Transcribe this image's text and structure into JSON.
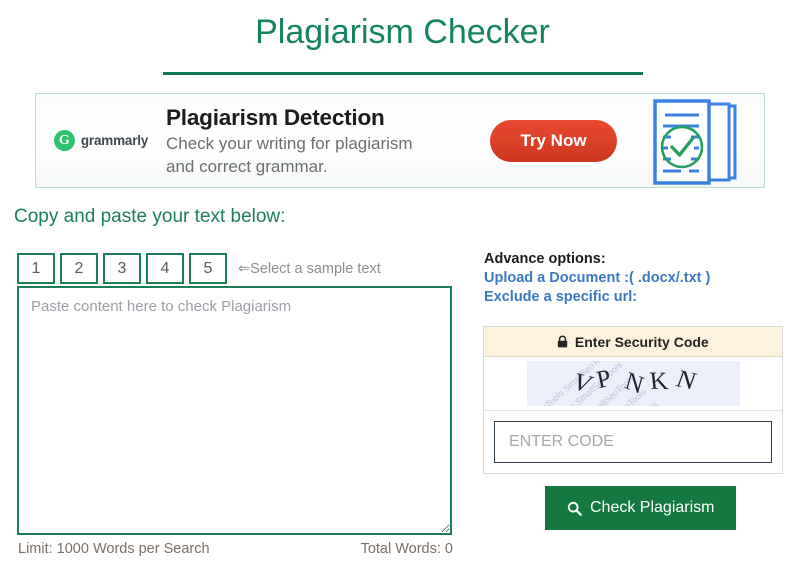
{
  "page": {
    "title": "Plagiarism Checker"
  },
  "ad": {
    "brand": "grammarly",
    "brand_mark": "G",
    "headline": "Plagiarism Detection",
    "subline_1": "Check your writing for plagiarism",
    "subline_2": "and correct grammar.",
    "cta_label": "Try Now",
    "artwork_icon": "document-check-icon",
    "colors": {
      "cta": "#d63a22",
      "brand": "#2ec26a",
      "doc_blue": "#3b82e0",
      "check_green": "#22a05e",
      "border": "#b9dfc9"
    }
  },
  "editor": {
    "section_label": "Copy and paste your text below:",
    "sample_buttons": [
      "1",
      "2",
      "3",
      "4",
      "5"
    ],
    "sample_hint_arrow": "⇐",
    "sample_hint": "Select a sample text",
    "textarea_placeholder": "Paste content here to check Plagiarism",
    "textarea_value": "",
    "limit_text": "Limit: 1000 Words per Search",
    "total_words_text": "Total Words: 0"
  },
  "advance": {
    "title": "Advance options:",
    "upload_link": "Upload a Document :( .docx/.txt )",
    "exclude_link": "Exclude a specific url:",
    "link_color": "#3a79c4"
  },
  "security": {
    "header_icon": "lock-icon",
    "header_glyph": "🔒",
    "header_label": "Enter Security Code",
    "captcha_characters": [
      "V",
      "P",
      "N",
      "K",
      "N"
    ],
    "captcha_text": "VPNKN",
    "captcha_watermark": "SmallSeoTools",
    "input_placeholder": "ENTER CODE",
    "input_value": "",
    "header_bg": "#fdf3dc"
  },
  "submit": {
    "icon": "search-icon",
    "label": "Check Plagiarism",
    "color": "#15793f"
  }
}
